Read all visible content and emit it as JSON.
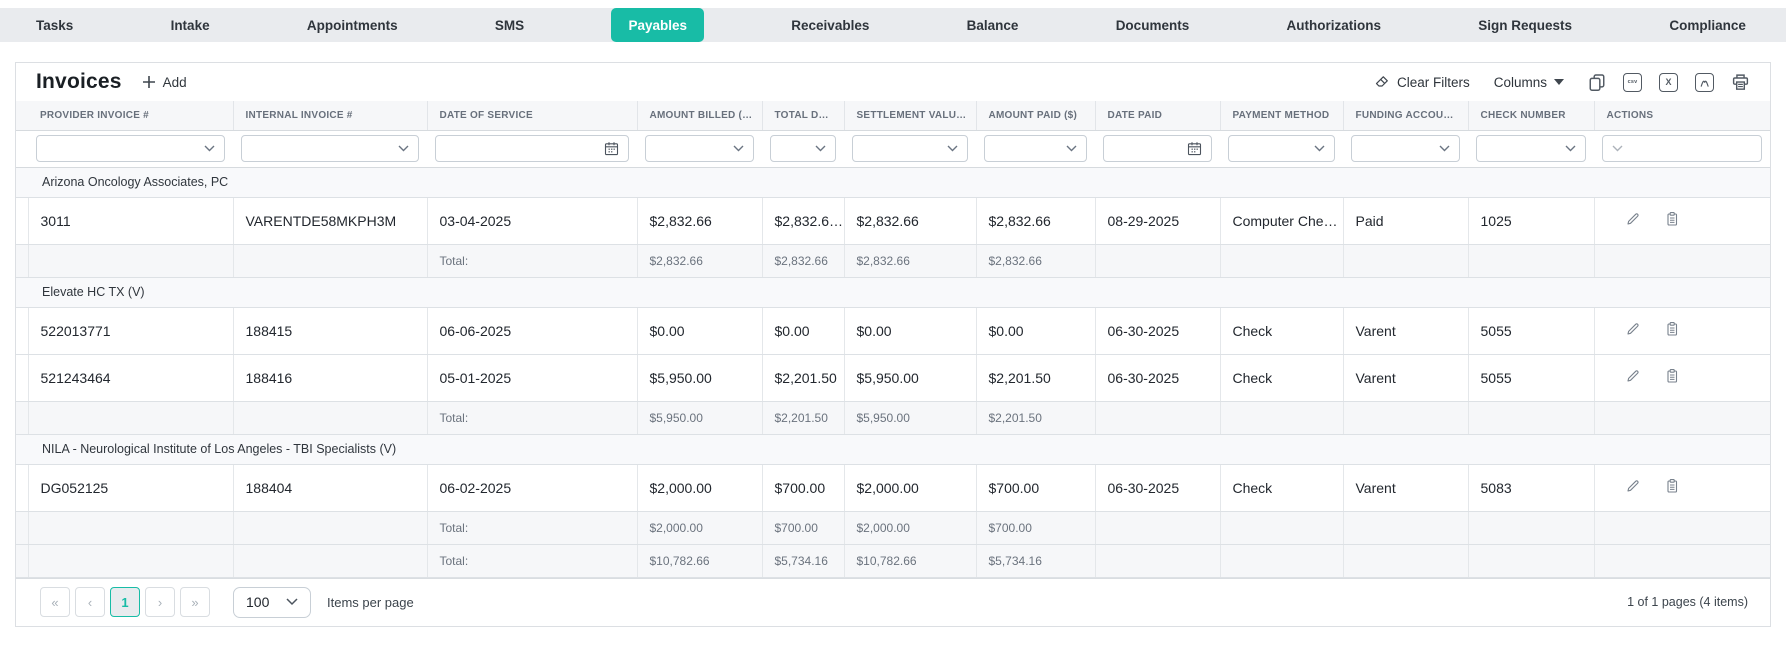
{
  "colors": {
    "accent": "#18bca6"
  },
  "nav": {
    "tabs": [
      {
        "label": "Tasks",
        "active": false
      },
      {
        "label": "Intake",
        "active": false
      },
      {
        "label": "Appointments",
        "active": false
      },
      {
        "label": "SMS",
        "active": false
      },
      {
        "label": "Payables",
        "active": true
      },
      {
        "label": "Receivables",
        "active": false
      },
      {
        "label": "Balance",
        "active": false
      },
      {
        "label": "Documents",
        "active": false
      },
      {
        "label": "Authorizations",
        "active": false
      },
      {
        "label": "Sign Requests",
        "active": false
      },
      {
        "label": "Compliance",
        "active": false
      }
    ]
  },
  "toolbar": {
    "title": "Invoices",
    "add_label": "Add",
    "clear_filters_label": "Clear Filters",
    "columns_label": "Columns",
    "csv_glyph": "csv",
    "excel_glyph": "X"
  },
  "table": {
    "columns": [
      "PROVIDER INVOICE #",
      "INTERNAL INVOICE #",
      "DATE OF SERVICE",
      "AMOUNT BILLED (…",
      "TOTAL D…",
      "SETTLEMENT VALU…",
      "AMOUNT PAID ($)",
      "DATE PAID",
      "PAYMENT METHOD",
      "FUNDING ACCOU…",
      "CHECK NUMBER",
      "ACTIONS"
    ],
    "total_label": "Total:",
    "groups": [
      {
        "name": "Arizona Oncology Associates, PC",
        "rows": [
          {
            "cells": [
              "3011",
              "VARENTDE58MKPH3M",
              "03-04-2025",
              "$2,832.66",
              "$2,832.6…",
              "$2,832.66",
              "$2,832.66",
              "08-29-2025",
              "Computer Che…",
              "Paid",
              "1025"
            ]
          }
        ],
        "totals": [
          "$2,832.66",
          "$2,832.66",
          "$2,832.66",
          "$2,832.66"
        ]
      },
      {
        "name": "Elevate HC TX (V)",
        "rows": [
          {
            "cells": [
              "522013771",
              "188415",
              "06-06-2025",
              "$0.00",
              "$0.00",
              "$0.00",
              "$0.00",
              "06-30-2025",
              "Check",
              "Varent",
              "5055"
            ]
          },
          {
            "cells": [
              "521243464",
              "188416",
              "05-01-2025",
              "$5,950.00",
              "$2,201.50",
              "$5,950.00",
              "$2,201.50",
              "06-30-2025",
              "Check",
              "Varent",
              "5055"
            ]
          }
        ],
        "totals": [
          "$5,950.00",
          "$2,201.50",
          "$5,950.00",
          "$2,201.50"
        ]
      },
      {
        "name": "NILA - Neurological Institute of Los Angeles - TBI Specialists (V)",
        "rows": [
          {
            "cells": [
              "DG052125",
              "188404",
              "06-02-2025",
              "$2,000.00",
              "$700.00",
              "$2,000.00",
              "$700.00",
              "06-30-2025",
              "Check",
              "Varent",
              "5083"
            ]
          }
        ],
        "totals": [
          "$2,000.00",
          "$700.00",
          "$2,000.00",
          "$700.00"
        ]
      }
    ],
    "grand_totals": [
      "$10,782.66",
      "$5,734.16",
      "$10,782.66",
      "$5,734.16"
    ]
  },
  "pager": {
    "first_icon": "«",
    "prev_icon": "‹",
    "page": "1",
    "next_icon": "›",
    "last_icon": "»",
    "page_size": "100",
    "items_per_page_label": "Items per page",
    "summary": "1 of 1 pages (4 items)"
  }
}
